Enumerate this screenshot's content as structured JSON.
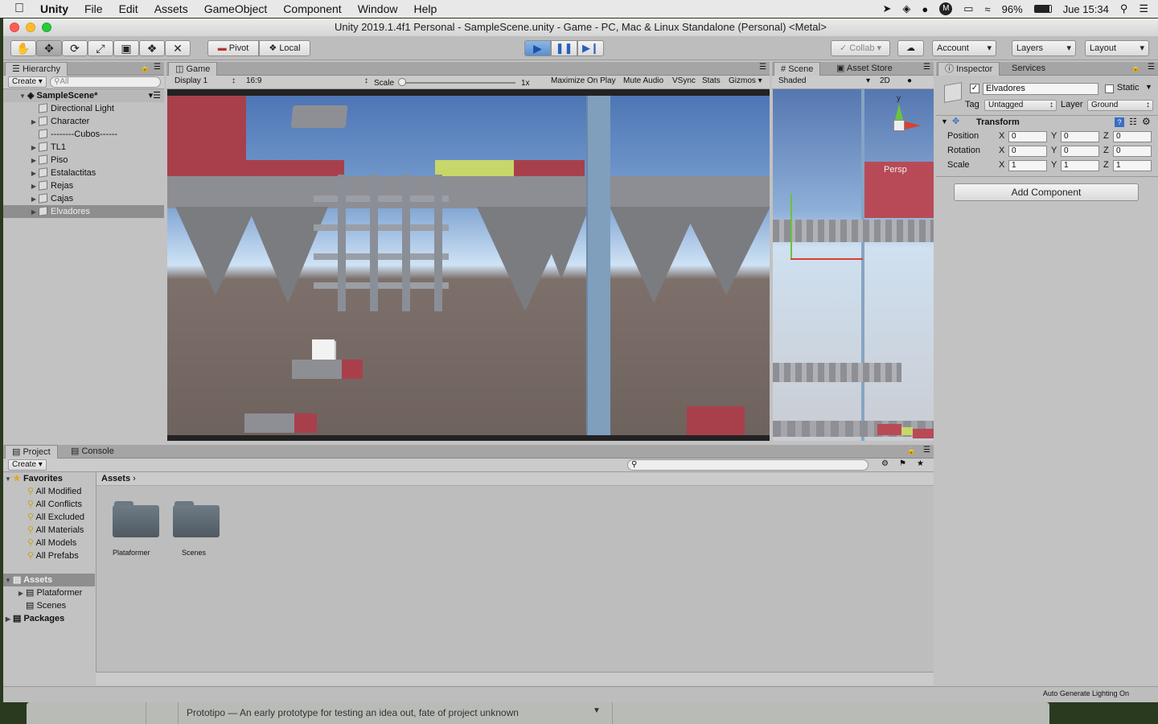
{
  "menubar": {
    "app": "Unity",
    "items": [
      "File",
      "Edit",
      "Assets",
      "GameObject",
      "Component",
      "Window",
      "Help"
    ],
    "battery": "96%",
    "clock": "Jue 15:34"
  },
  "window": {
    "title": "Unity 2019.1.4f1 Personal - SampleScene.unity - Game - PC, Mac & Linux Standalone (Personal) <Metal>"
  },
  "toolbar": {
    "pivot": "Pivot",
    "local": "Local",
    "collab": "Collab",
    "account": "Account",
    "layers": "Layers",
    "layout": "Layout"
  },
  "hierarchy": {
    "tab": "Hierarchy",
    "create": "Create",
    "search_placeholder": "All",
    "scene": "SampleScene*",
    "items": [
      {
        "label": "Directional Light",
        "expand": false
      },
      {
        "label": "Character",
        "expand": true
      },
      {
        "label": "--------Cubos------",
        "expand": false
      },
      {
        "label": "TL1",
        "expand": true
      },
      {
        "label": "Piso",
        "expand": true
      },
      {
        "label": "Estalactitas",
        "expand": true
      },
      {
        "label": "Rejas",
        "expand": true
      },
      {
        "label": "Cajas",
        "expand": true
      },
      {
        "label": "Elvadores",
        "expand": true
      }
    ]
  },
  "game": {
    "tab": "Game",
    "display": "Display 1",
    "aspect": "16:9",
    "scale_label": "Scale",
    "scale_value": "1x",
    "buttons": [
      "Maximize On Play",
      "Mute Audio",
      "VSync",
      "Stats",
      "Gizmos"
    ]
  },
  "scene": {
    "tab": "Scene",
    "asset_store": "Asset Store",
    "shaded": "Shaded",
    "mode2d": "2D",
    "persp": "Persp",
    "gizmo_y": "y"
  },
  "inspector": {
    "tab": "Inspector",
    "services": "Services",
    "object_name": "Elvadores",
    "static": "Static",
    "tag_label": "Tag",
    "tag_value": "Untagged",
    "layer_label": "Layer",
    "layer_value": "Ground",
    "transform": "Transform",
    "position_label": "Position",
    "rotation_label": "Rotation",
    "scale_label": "Scale",
    "position": {
      "x": "0",
      "y": "0",
      "z": "0"
    },
    "rotation": {
      "x": "0",
      "y": "0",
      "z": "0"
    },
    "scale": {
      "x": "1",
      "y": "1",
      "z": "1"
    },
    "add_component": "Add Component",
    "axis_x": "X",
    "axis_y": "Y",
    "axis_z": "Z"
  },
  "project": {
    "tab": "Project",
    "console": "Console",
    "create": "Create",
    "favorites": "Favorites",
    "favorite_items": [
      "All Modified",
      "All Conflicts",
      "All Excluded",
      "All Materials",
      "All Models",
      "All Prefabs"
    ],
    "assets": "Assets",
    "asset_folders": [
      "Plataformer",
      "Scenes"
    ],
    "packages": "Packages",
    "breadcrumb": "Assets",
    "grid_items": [
      "Plataformer",
      "Scenes"
    ]
  },
  "statusbar": {
    "lighting": "Auto Generate Lighting On"
  },
  "dock": {
    "text": "Prototipo — An early prototype for testing an idea out, fate of project unknown"
  }
}
